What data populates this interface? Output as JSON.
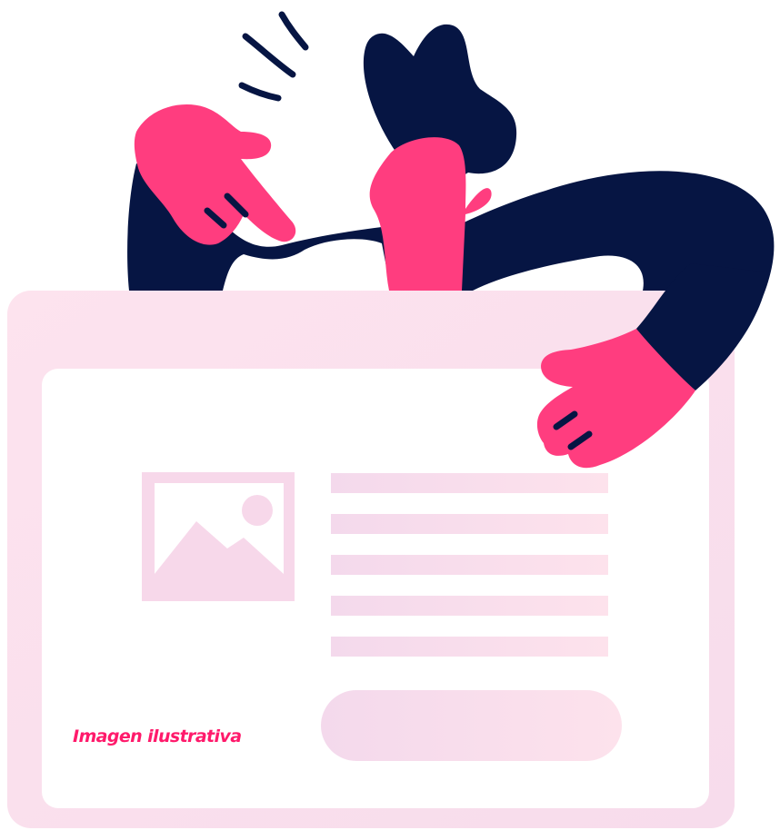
{
  "caption": {
    "text": "Imagen ilustrativa"
  },
  "colors": {
    "accent_pink": "#ff3d7f",
    "caption_pink": "#ff1a6b",
    "navy": "#061543",
    "frame_pink": "#fde0ec",
    "placeholder_pink": "#f7d8ea",
    "card_white": "#ffffff"
  },
  "illustration": {
    "subject": "person-peeking-over-browser-card",
    "icons": [
      "image-placeholder-icon",
      "text-lines",
      "button-placeholder"
    ]
  }
}
